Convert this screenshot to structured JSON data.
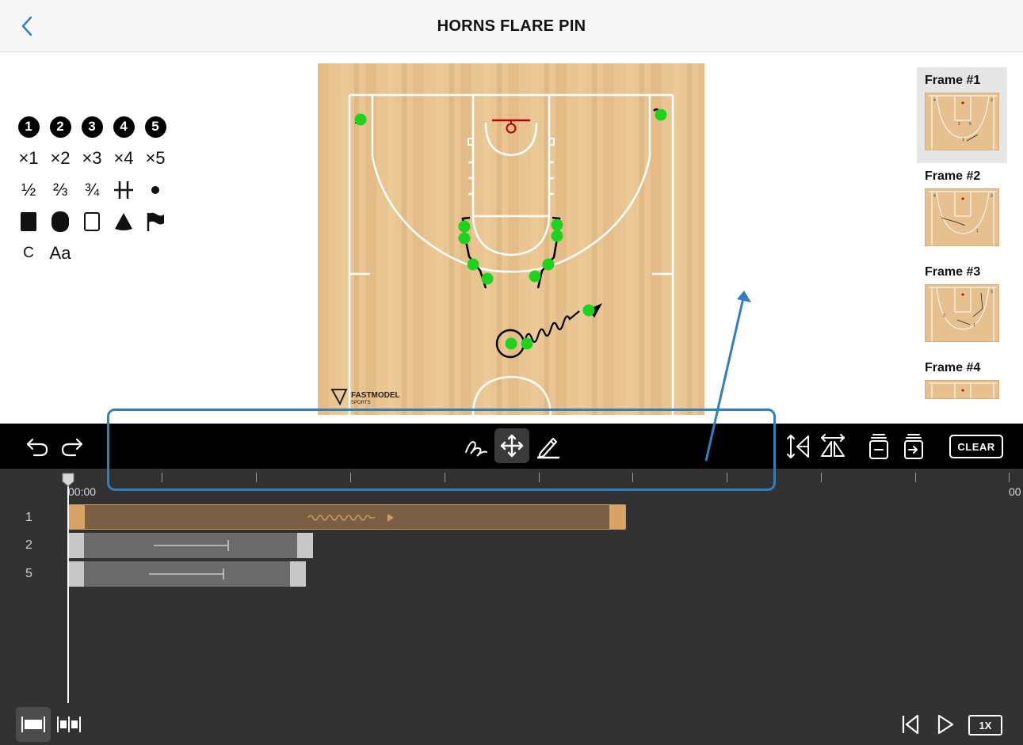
{
  "header": {
    "title": "HORNS FLARE PIN",
    "back_icon": "chevron-left-icon"
  },
  "palette": {
    "row1": [
      "1",
      "2",
      "3",
      "4",
      "5"
    ],
    "row2": [
      "×1",
      "×2",
      "×3",
      "×4",
      "×5"
    ],
    "row3": [
      "½",
      "⅔",
      "¾",
      "screen-icon",
      "dot-icon"
    ],
    "row4": [
      "square-icon",
      "oval-icon",
      "rectangle-outline-icon",
      "cone-icon",
      "flag-icon"
    ],
    "row5": [
      "C",
      "Aa"
    ]
  },
  "court": {
    "logo_top": "FASTMODEL",
    "logo_bottom": "SPORTS"
  },
  "frames": [
    {
      "label": "Frame #1",
      "selected": true
    },
    {
      "label": "Frame #2",
      "selected": false
    },
    {
      "label": "Frame #3",
      "selected": false
    },
    {
      "label": "Frame #4",
      "selected": false
    }
  ],
  "toolbar": {
    "clear_label": "CLEAR",
    "icons": [
      "undo-icon",
      "redo-icon",
      "freehand-icon",
      "move-icon",
      "pencil-icon",
      "flip-vertical-icon",
      "flip-horizontal-icon",
      "remove-frame-icon",
      "next-frame-icon"
    ]
  },
  "timeline": {
    "start_time": "00:00",
    "end_time_partial": "00",
    "tracks": [
      {
        "label": "1",
        "type": "dribble"
      },
      {
        "label": "2",
        "type": "screen"
      },
      {
        "label": "5",
        "type": "screen"
      }
    ]
  },
  "playback": {
    "speed_label": "1X",
    "icons": [
      "timeline-view-icon",
      "split-view-icon",
      "skip-back-icon",
      "play-icon"
    ]
  },
  "colors": {
    "accent": "#2f7fc1",
    "court": "#e7c08f",
    "player": "#1ed21e",
    "toolbar": "#000000",
    "timeline": "#323232"
  }
}
